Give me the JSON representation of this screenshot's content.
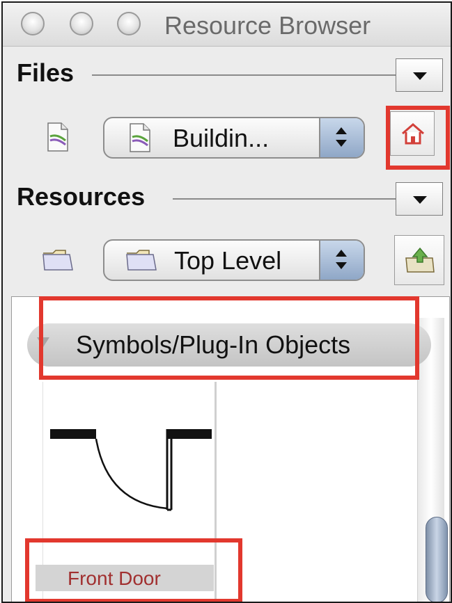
{
  "window": {
    "title": "Resource Browser"
  },
  "files": {
    "section_title": "Files",
    "selector_value": "Buildin...",
    "file_icon": "document-icon",
    "home_icon": "home-icon"
  },
  "resources": {
    "section_title": "Resources",
    "selector_value": "Top Level",
    "folder_icon": "folder-icon",
    "up_icon": "folder-up-icon"
  },
  "list": {
    "group_label": "Symbols/Plug-In Objects",
    "items": [
      {
        "label": "Front Door",
        "icon": "door-symbol"
      }
    ]
  },
  "colors": {
    "highlight": "#e2382e",
    "item_label": "#a13030"
  }
}
